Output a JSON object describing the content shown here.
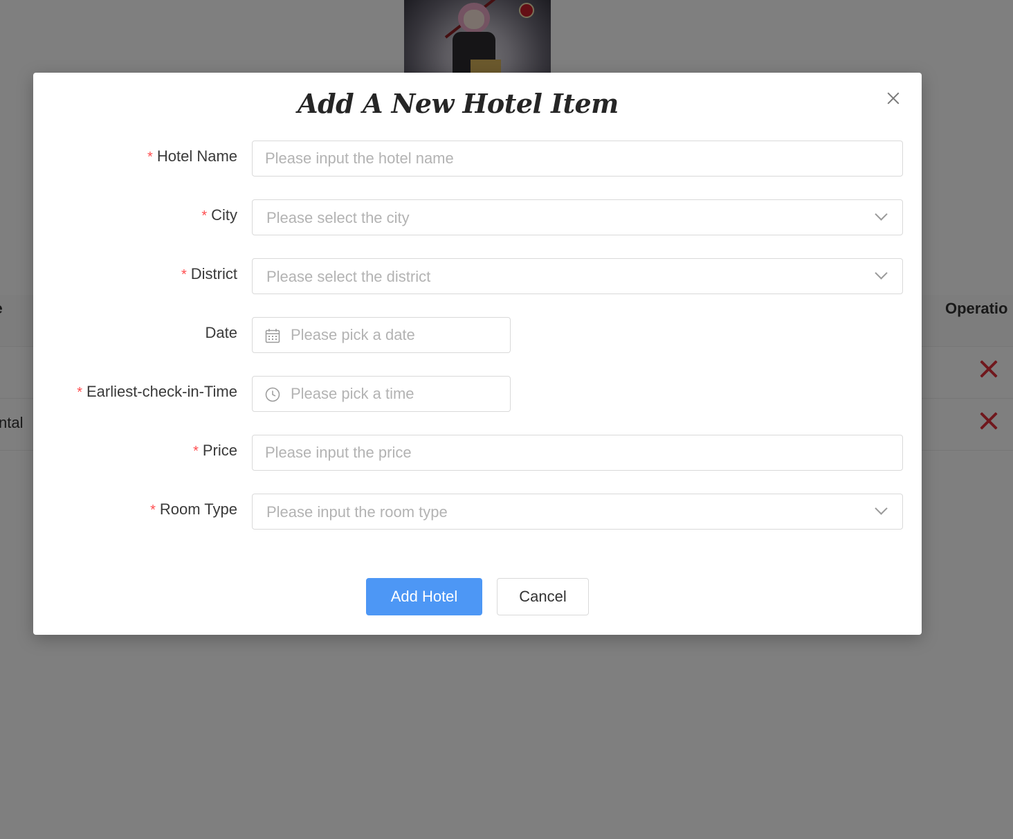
{
  "background": {
    "table_header_left": "ne",
    "table_header_right": "Operatio",
    "rows": [
      {
        "text": ""
      },
      {
        "text": "ntal"
      }
    ],
    "delete_color": "#e0303b"
  },
  "modal": {
    "title": "Add A New Hotel Item",
    "fields": {
      "hotel_name": {
        "label": "Hotel Name",
        "required": true,
        "placeholder": "Please input the hotel name"
      },
      "city": {
        "label": "City",
        "required": true,
        "placeholder": "Please select the city"
      },
      "district": {
        "label": "District",
        "required": true,
        "placeholder": "Please select the district"
      },
      "date": {
        "label": "Date",
        "required": false,
        "placeholder": "Please pick a date"
      },
      "checkin_time": {
        "label": "Earliest-check-in-Time",
        "required": true,
        "placeholder": "Please pick a time"
      },
      "price": {
        "label": "Price",
        "required": true,
        "placeholder": "Please input the price"
      },
      "room_type": {
        "label": "Room Type",
        "required": true,
        "placeholder": "Please input the room type"
      }
    },
    "required_mark": "*",
    "submit_label": "Add Hotel",
    "cancel_label": "Cancel"
  },
  "colors": {
    "primary": "#4d97f5",
    "required": "#ff4d4f",
    "mask": "rgba(0,0,0,0.5)"
  },
  "icons": {
    "date": "calendar-icon",
    "time": "clock-icon",
    "close": "close-icon",
    "select": "chevron-down-icon"
  }
}
